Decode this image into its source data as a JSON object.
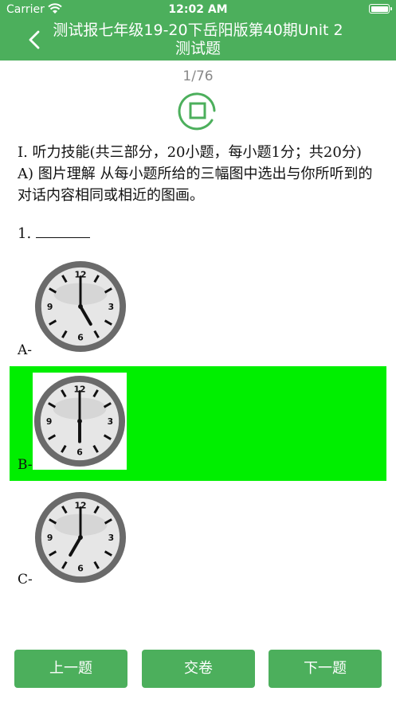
{
  "status_bar": {
    "carrier": "Carrier",
    "time": "12:02 AM"
  },
  "nav": {
    "title": "测试报七年级19-20下岳阳版第40期Unit 2测试题"
  },
  "progress": {
    "counter": "1/76"
  },
  "question": {
    "section_title": "Ⅰ. 听力技能(共三部分，20小题，每小题1分；共20分)",
    "part_instruction": "A) 图片理解 从每小题所给的三幅图中选出与你所听到的对话内容相同或相近的图画。",
    "number": "1. "
  },
  "options": [
    {
      "label": "A-",
      "clock_time": "5:00",
      "selected": false
    },
    {
      "label": "B-",
      "clock_time": "6:00",
      "selected": true
    },
    {
      "label": "C-",
      "clock_time": "7:00",
      "selected": false
    }
  ],
  "buttons": {
    "prev": "上一题",
    "submit": "交卷",
    "next": "下一题"
  },
  "colors": {
    "brand_green": "#4caf5c",
    "selected_highlight": "#00ef00"
  }
}
